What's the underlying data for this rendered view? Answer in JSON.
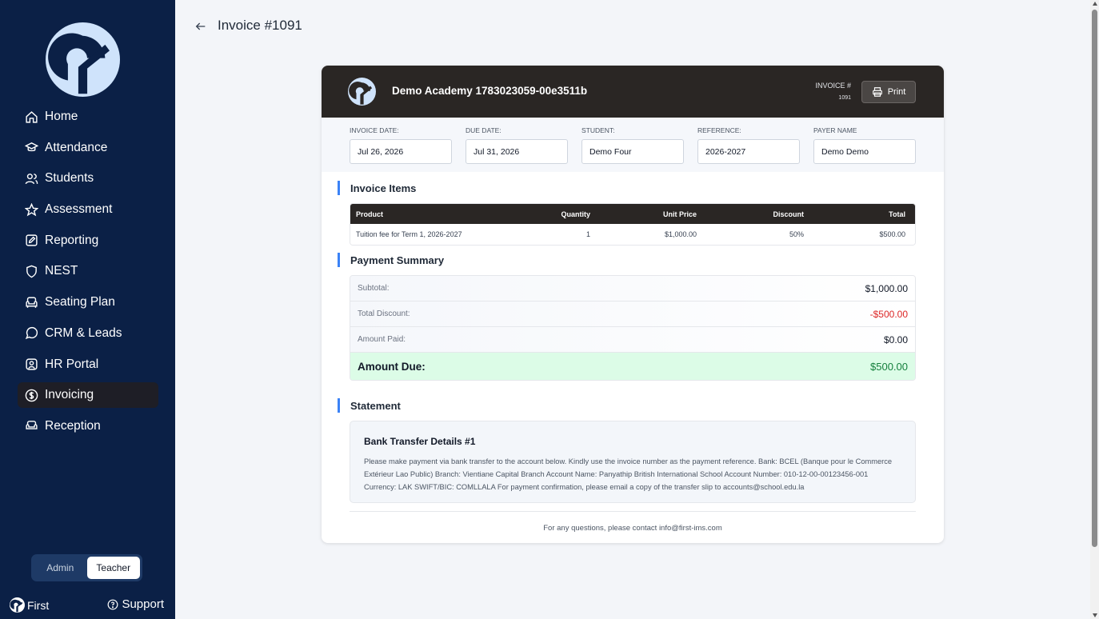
{
  "sidebar": {
    "items": [
      {
        "label": "Home"
      },
      {
        "label": "Attendance"
      },
      {
        "label": "Students"
      },
      {
        "label": "Assessment"
      },
      {
        "label": "Reporting"
      },
      {
        "label": "NEST"
      },
      {
        "label": "Seating Plan"
      },
      {
        "label": "CRM & Leads"
      },
      {
        "label": "HR Portal"
      },
      {
        "label": "Invoicing"
      },
      {
        "label": "Reception"
      }
    ],
    "active_index": 9,
    "roles": [
      "Admin",
      "Teacher"
    ],
    "selected_role": "Teacher",
    "brand": "First",
    "support": "Support"
  },
  "page": {
    "title": "Invoice #1091"
  },
  "invoice": {
    "academy": "Demo Academy 1783023059-00e3511b",
    "number_label": "INVOICE #",
    "number": "1091",
    "print_label": "Print",
    "meta": [
      {
        "label": "INVOICE DATE:",
        "value": "Jul 26, 2026"
      },
      {
        "label": "DUE DATE:",
        "value": "Jul 31, 2026"
      },
      {
        "label": "STUDENT:",
        "value": "Demo Four"
      },
      {
        "label": "REFERENCE:",
        "value": "2026-2027"
      },
      {
        "label": "PAYER NAME",
        "value": "Demo Demo"
      }
    ],
    "items_title": "Invoice Items",
    "columns": [
      "Product",
      "Quantity",
      "Unit Price",
      "Discount",
      "Total"
    ],
    "rows": [
      [
        "Tuition fee for Term 1, 2026-2027",
        "1",
        "$1,000.00",
        "50%",
        "$500.00"
      ]
    ],
    "summary_title": "Payment Summary",
    "summary": {
      "subtotal_label": "Subtotal:",
      "subtotal": "$1,000.00",
      "discount_label": "Total Discount:",
      "discount": "-$500.00",
      "paid_label": "Amount Paid:",
      "paid": "$0.00",
      "due_label": "Amount Due:",
      "due": "$500.00"
    },
    "statement_title": "Statement",
    "statement": {
      "heading": "Bank Transfer Details #1",
      "text": "Please make payment via bank transfer to the account below. Kindly use the invoice number as the payment reference.  Bank: BCEL (Banque pour le Commerce Extérieur Lao Public) Branch: Vientiane Capital Branch Account Name: Panyathip British International School Account Number: 010-12-00-00123456-001 Currency: LAK SWIFT/BIC: COMLLALA  For payment confirmation, please email a copy of the transfer slip to accounts@school.edu.la"
    },
    "footer": "For any questions, please contact info@first-ims.com"
  },
  "colors": {
    "sidebar_bg": "#0b2046",
    "header_bg": "#2a2624",
    "accent": "#3b82f6",
    "due_bg": "#dcfce7",
    "due_text": "#15803d",
    "negative": "#dc2626"
  }
}
